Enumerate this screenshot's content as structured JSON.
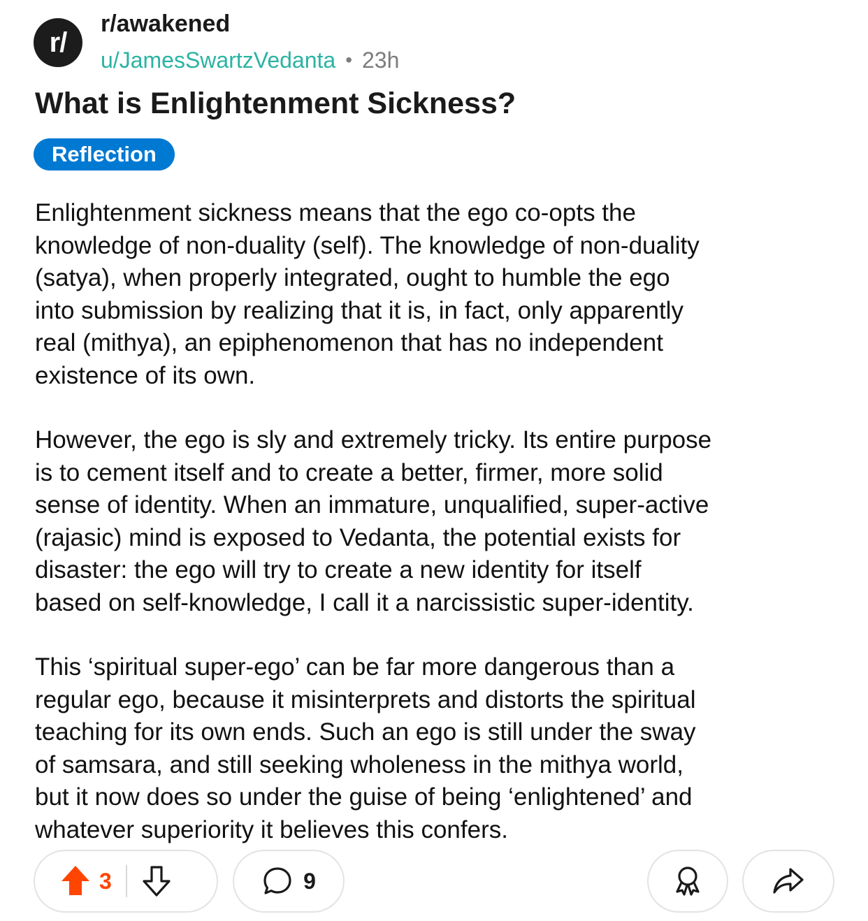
{
  "post": {
    "subreddit_icon_text": "r/",
    "subreddit": "r/awakened",
    "author": "u/JamesSwartzVedanta",
    "separator": "•",
    "time_ago": "23h",
    "title": "What is Enlightenment Sickness?",
    "flair": "Reflection",
    "paragraphs": [
      "Enlightenment sickness means that the ego co-opts the\nknowledge of non-duality (self). The knowledge of non-duality\n(satya), when properly integrated, ought to humble the ego\ninto submission by realizing that it is, in fact, only apparently\nreal (mithya), an epiphenomenon that has no independent\nexistence of its own.",
      "However, the ego is sly and extremely tricky. Its entire purpose\nis to cement itself and to create a better, firmer, more solid\nsense of identity. When an immature, unqualified, super-active\n(rajasic) mind is exposed to Vedanta, the potential exists for\ndisaster:  the ego will try to create a new identity for itself\nbased on self-knowledge, I call it a narcissistic super-identity.",
      "This ‘spiritual super-ego’ can be far more dangerous than a\nregular ego, because it misinterprets and distorts the spiritual\nteaching for its own ends. Such an ego is still under the sway\nof samsara, and still seeking wholeness in the mithya world,\nbut it now does so under the guise of being ‘enlightened’ and\nwhatever superiority it believes this confers."
    ]
  },
  "actions": {
    "upvote_icon": "arrow-up-icon",
    "vote_count": "3",
    "downvote_icon": "arrow-down-icon",
    "comment_icon": "speech-bubble-icon",
    "comment_count": "9",
    "award_icon": "award-ribbon-icon",
    "share_icon": "share-arrow-icon"
  },
  "colors": {
    "username": "#2bb3a3",
    "flair_bg": "#0079d3",
    "upvoted": "#ff4500",
    "muted": "#7c7c7c"
  }
}
